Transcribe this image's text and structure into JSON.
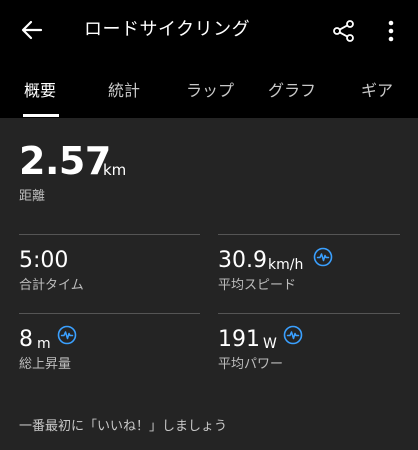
{
  "header": {
    "title": "ロードサイクリング",
    "back_icon": "arrow-left-icon",
    "share_icon": "share-icon",
    "more_icon": "more-vertical-icon"
  },
  "tabs": [
    {
      "label": "概要",
      "active": true
    },
    {
      "label": "統計",
      "active": false
    },
    {
      "label": "ラップ",
      "active": false
    },
    {
      "label": "グラフ",
      "active": false
    },
    {
      "label": "ギア",
      "active": false
    }
  ],
  "distance": {
    "value": "2.57",
    "unit": "km",
    "label": "距離"
  },
  "stats": {
    "total_time": {
      "value": "5:00",
      "unit": "",
      "label": "合計タイム"
    },
    "avg_speed": {
      "value": "30.9",
      "unit": "km/h",
      "label": "平均スピード",
      "icon": "chart-pulse-icon"
    },
    "total_ascent": {
      "value": "8",
      "unit": "m",
      "label": "総上昇量",
      "icon": "chart-pulse-icon"
    },
    "avg_power": {
      "value": "191",
      "unit": "W",
      "label": "平均パワー",
      "icon": "chart-pulse-icon"
    }
  },
  "like_prompt": "一番最初に「いいね！」しましょう",
  "colors": {
    "background": "#000000",
    "panel": "#242424",
    "accent": "#3aa0ff",
    "divider": "#555555"
  }
}
